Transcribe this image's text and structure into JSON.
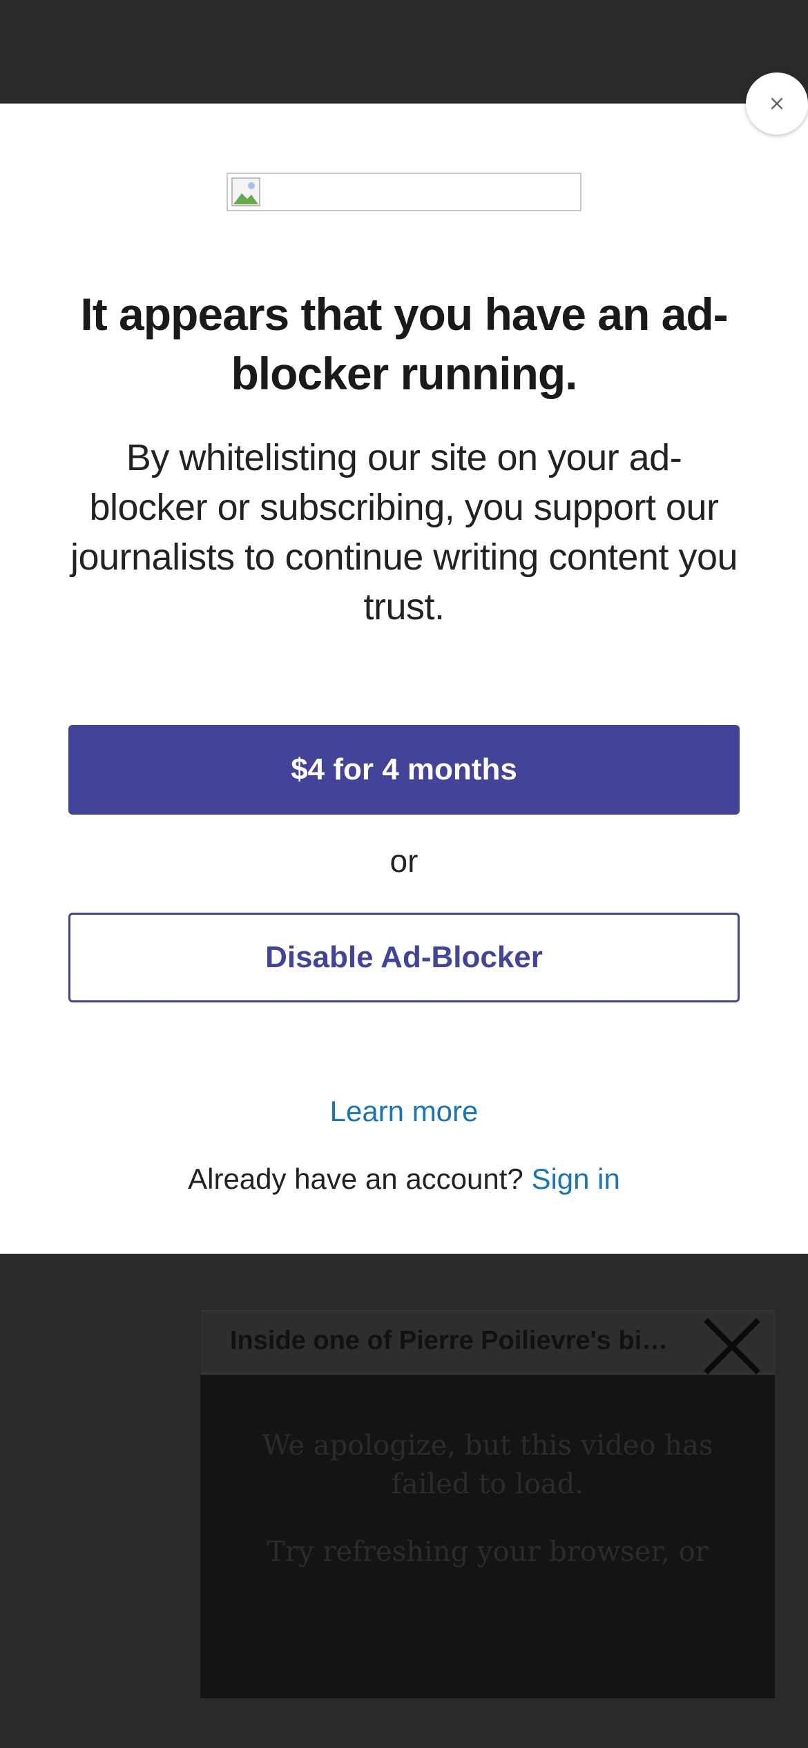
{
  "modal": {
    "close_icon": "close-icon",
    "logo_icon": "broken-image-icon",
    "heading": "It appears that you have an ad-blocker running.",
    "body": "By whitelisting our site on your ad-blocker or subscribing, you support our journalists to continue writing content you trust.",
    "subscribe_label": "$4 for 4 months",
    "or_label": "or",
    "disable_label": "Disable Ad-Blocker",
    "learn_more_label": "Learn more",
    "account_prompt": "Already have an account?",
    "sign_in_label": "Sign in"
  },
  "video": {
    "title": "Inside one of Pierre Poilievre's big...",
    "close_icon": "close-x-icon",
    "error_message": "We apologize, but this video has failed to load.",
    "retry_message": "Try refreshing your browser, or"
  },
  "colors": {
    "accent": "#434499",
    "link": "#1a74b8",
    "backdrop": "#2a2a2d"
  }
}
